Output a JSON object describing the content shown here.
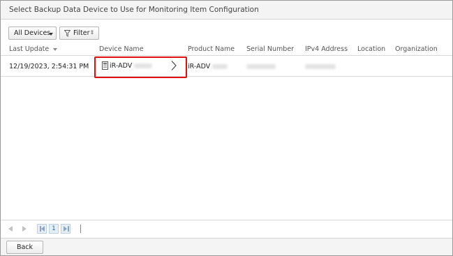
{
  "dialog": {
    "title": "Select Backup Data Device to Use for Monitoring Item Configuration"
  },
  "toolbar": {
    "devices_dropdown": "All Devices",
    "filter_label": "Filter"
  },
  "table": {
    "columns": [
      "Last Update",
      "Device Name",
      "Product Name",
      "Serial Number",
      "IPv4 Address",
      "Location",
      "Organization"
    ],
    "rows": [
      {
        "last_update": "12/19/2023, 2:54:31 PM",
        "device_name": "iR-ADV",
        "product_name": "iR-ADV",
        "serial_number": "",
        "ipv4_address": "",
        "location": "",
        "organization": ""
      }
    ]
  },
  "pager": {
    "current_page": "1"
  },
  "footer": {
    "back_label": "Back"
  },
  "colors": {
    "highlight": "#e01010",
    "pager_accent": "#2a5d93"
  }
}
